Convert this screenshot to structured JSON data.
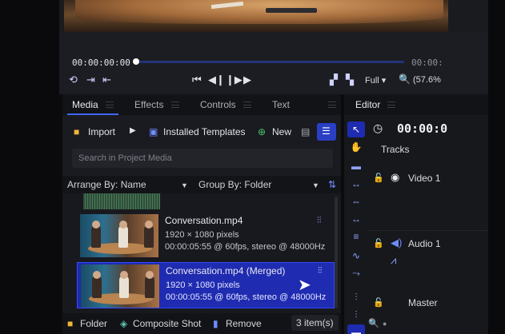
{
  "transport": {
    "current_timecode": "00:00:00:00",
    "end_timecode": "00:00:",
    "quality": "Full",
    "zoom": "(57.6%"
  },
  "media_panel": {
    "tabs": [
      {
        "label": "Media",
        "active": true
      },
      {
        "label": "Effects",
        "active": false
      },
      {
        "label": "Controls",
        "active": false
      },
      {
        "label": "Text",
        "active": false
      }
    ],
    "toolbar": {
      "import_label": "Import",
      "templates_label": "Installed Templates",
      "new_label": "New"
    },
    "search": {
      "placeholder": "Search in Project Media"
    },
    "arrange_by": "Arrange By: Name",
    "group_by": "Group By: Folder",
    "items": [
      {
        "name": "Conversation.mp4",
        "resolution": "1920 × 1080 pixels",
        "details": "00:00:05:55 @ 60fps, stereo @ 48000Hz",
        "selected": false
      },
      {
        "name": "Conversation.mp4 (Merged)",
        "resolution": "1920 × 1080 pixels",
        "details": "00:00:05:55 @ 60fps, stereo @ 48000Hz",
        "selected": true
      }
    ],
    "bottom": {
      "folder_label": "Folder",
      "composite_label": "Composite Shot",
      "remove_label": "Remove",
      "count": "3 item(s)"
    }
  },
  "editor": {
    "tab_label": "Editor",
    "timecode": "00:00:0",
    "tracks_label": "Tracks",
    "tracks": [
      {
        "name": "Video 1"
      },
      {
        "name": "Audio 1"
      },
      {
        "name": "Master"
      }
    ]
  },
  "colors": {
    "accent": "#3f66ff",
    "selection": "#1f2bb0",
    "panel": "#1a1b20"
  }
}
